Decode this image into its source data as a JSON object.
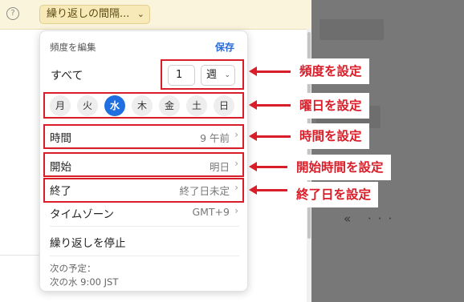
{
  "top_bar": {
    "help_icon": "?",
    "repeat_button_label": "繰り返しの間隔...",
    "repeat_chevron": "⌄"
  },
  "popover": {
    "title": "頻度を編集",
    "save_label": "保存",
    "all_label": "すべて",
    "frequency_value": "1",
    "unit_value": "週",
    "unit_chevron": "⌄",
    "days": [
      "月",
      "火",
      "水",
      "木",
      "金",
      "土",
      "日"
    ],
    "selected_day": "水",
    "time": {
      "label": "時間",
      "value": "9 午前"
    },
    "start": {
      "label": "開始",
      "value": "明日"
    },
    "end": {
      "label": "終了",
      "value": "終了日未定"
    },
    "timezone": {
      "label": "タイムゾーン",
      "value": "GMT+9"
    },
    "row_chevron": "›",
    "stop_label": "繰り返しを停止",
    "next_label": "次の予定：",
    "next_value": "次の水 9:00 JST"
  },
  "annotations": {
    "frequency": "頻度を設定",
    "weekday": "曜日を設定",
    "time": "時間を設定",
    "start": "開始時間を設定",
    "end": "終了日を設定"
  },
  "right_panel": {
    "icons": "«  ···"
  },
  "colors": {
    "accent_blue": "#1f6fe0",
    "highlight_red": "#d91e2a",
    "top_bar_bg": "#fbf4dc"
  }
}
